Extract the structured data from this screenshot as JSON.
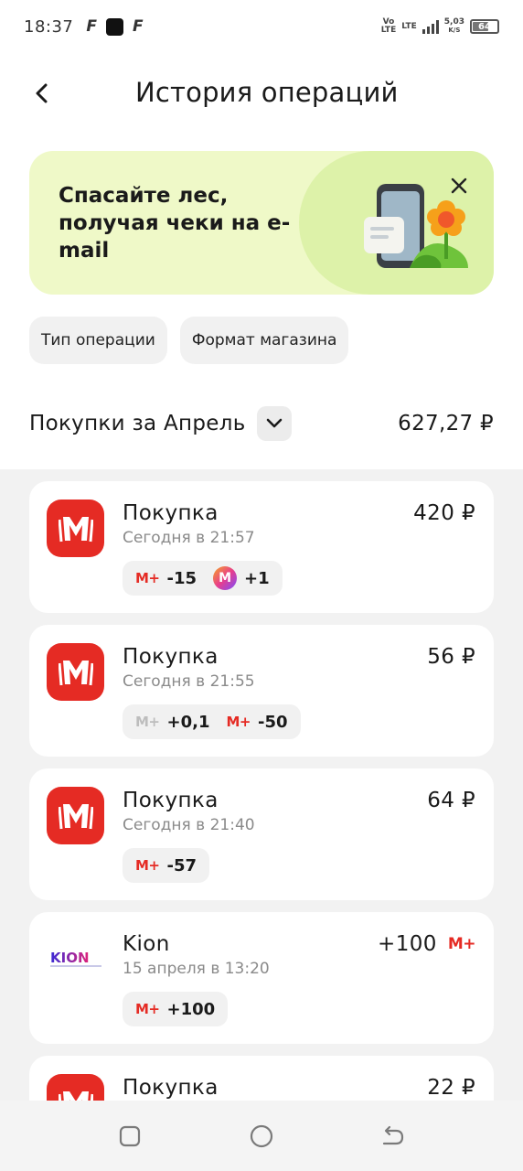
{
  "status_bar": {
    "time": "18:37",
    "app_icons": [
      "F",
      "F"
    ],
    "network_1": "Vo\nLTE",
    "network_2": "LTE",
    "speed_value": "5,03",
    "speed_unit": "K/S",
    "battery": "64"
  },
  "header": {
    "title": "История операций",
    "back_icon": "chevron-left-icon"
  },
  "banner": {
    "text": "Спасайте лес, получая чеки на e-mail",
    "close_icon": "close-icon",
    "colors": {
      "background": "#eff9c8",
      "accent": "#ddf2a9"
    }
  },
  "filters": [
    {
      "label": "Тип операции"
    },
    {
      "label": "Формат магазина"
    }
  ],
  "summary": {
    "label": "Покупки за Апрель",
    "total": "627,27 ₽",
    "toggle_icon": "chevron-down-icon"
  },
  "transactions": [
    {
      "title": "Покупка",
      "time": "Сегодня в 21:57",
      "amount": "420 ₽",
      "logo": "magnit-logo",
      "bonuses": [
        {
          "icon": "m-plus-icon",
          "icon_text": "M+",
          "value": "-15",
          "style": "red"
        },
        {
          "icon": "m-coin-icon",
          "icon_text": "M",
          "value": "+1",
          "style": "coin"
        }
      ]
    },
    {
      "title": "Покупка",
      "time": "Сегодня в 21:55",
      "amount": "56 ₽",
      "logo": "magnit-logo",
      "bonuses": [
        {
          "icon": "m-plus-icon",
          "icon_text": "M+",
          "value": "+0,1",
          "style": "grey"
        },
        {
          "icon": "m-plus-icon",
          "icon_text": "M+",
          "value": "-50",
          "style": "red"
        }
      ]
    },
    {
      "title": "Покупка",
      "time": "Сегодня в 21:40",
      "amount": "64 ₽",
      "logo": "magnit-logo",
      "bonuses": [
        {
          "icon": "m-plus-icon",
          "icon_text": "M+",
          "value": "-57",
          "style": "red"
        }
      ]
    },
    {
      "title": "Kion",
      "time": "15 апреля в 13:20",
      "amount": "+100",
      "amount_icon_text": "M+",
      "logo": "kion-logo",
      "logo_text": "KION",
      "bonuses": [
        {
          "icon": "m-plus-icon",
          "icon_text": "M+",
          "value": "+100",
          "style": "red"
        }
      ]
    },
    {
      "title": "Покупка",
      "amount": "22 ₽",
      "logo": "magnit-logo"
    }
  ],
  "navbar": {
    "buttons": [
      "recent-apps-icon",
      "home-icon",
      "back-icon"
    ]
  },
  "colors": {
    "brand_red": "#e52b24",
    "list_background": "#f2f2f2",
    "chip_background": "#f1f1f1"
  }
}
